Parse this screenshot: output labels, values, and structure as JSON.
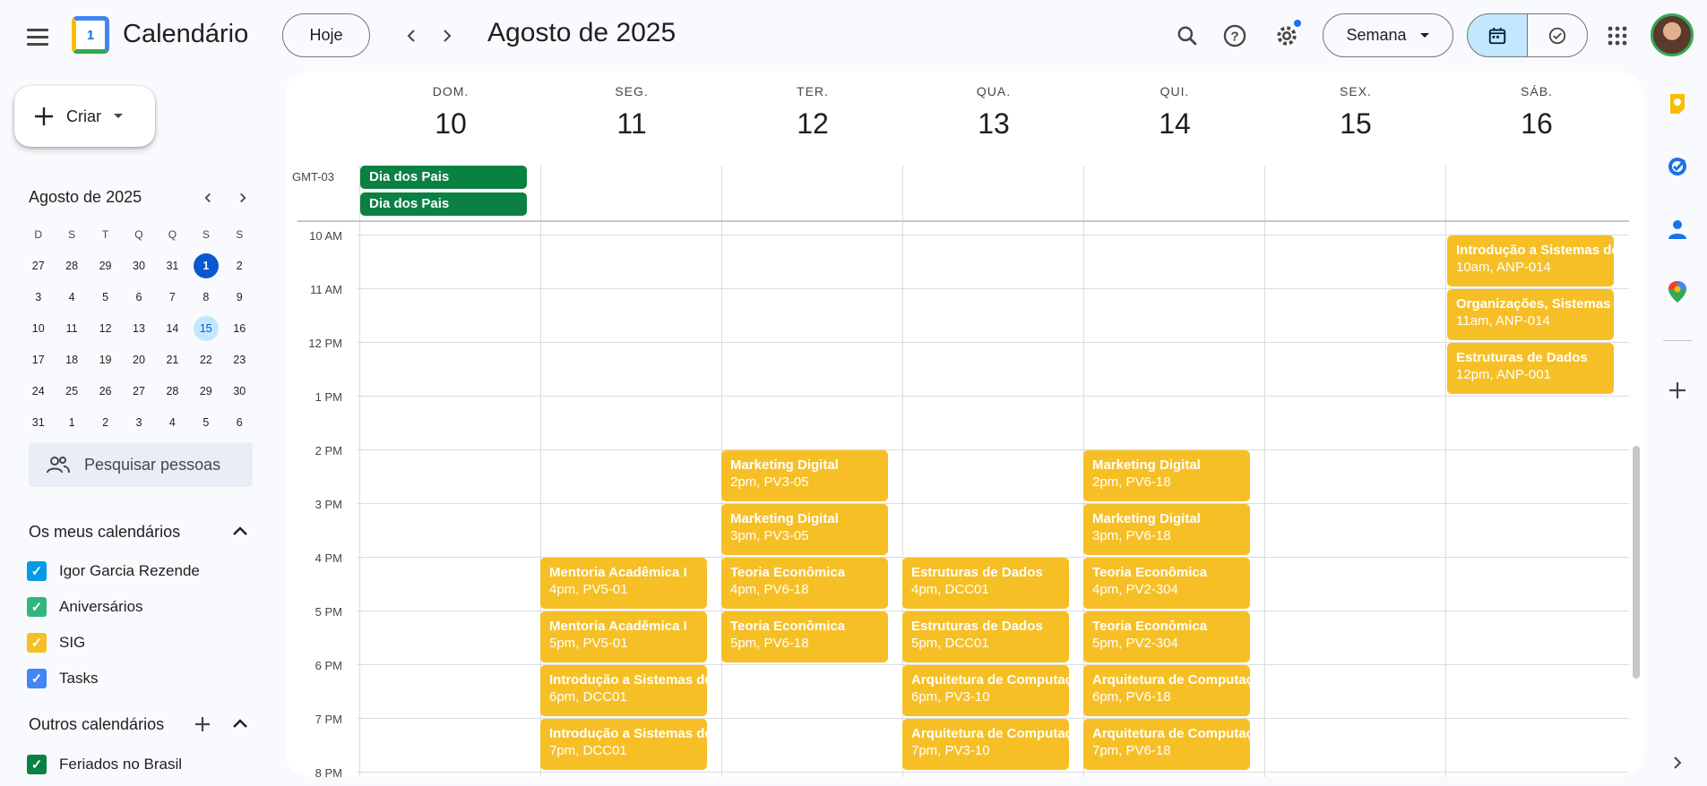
{
  "header": {
    "app_title": "Calendário",
    "logo_number": "1",
    "today_label": "Hoje",
    "period": "Agosto de 2025",
    "view_label": "Semana"
  },
  "sidebar": {
    "create_label": "Criar",
    "mini_cal": {
      "title": "Agosto de 2025",
      "weekdays": [
        "D",
        "S",
        "T",
        "Q",
        "Q",
        "S",
        "S"
      ],
      "weeks": [
        [
          "27",
          "28",
          "29",
          "30",
          "31",
          "1",
          "2"
        ],
        [
          "3",
          "4",
          "5",
          "6",
          "7",
          "8",
          "9"
        ],
        [
          "10",
          "11",
          "12",
          "13",
          "14",
          "15",
          "16"
        ],
        [
          "17",
          "18",
          "19",
          "20",
          "21",
          "22",
          "23"
        ],
        [
          "24",
          "25",
          "26",
          "27",
          "28",
          "29",
          "30"
        ],
        [
          "31",
          "1",
          "2",
          "3",
          "4",
          "5",
          "6"
        ]
      ]
    },
    "search_people": "Pesquisar pessoas",
    "my_calendars_title": "Os meus calendários",
    "my_calendars": [
      {
        "label": "Igor Garcia Rezende",
        "color": "#039be5"
      },
      {
        "label": "Aniversários",
        "color": "#33b679"
      },
      {
        "label": "SIG",
        "color": "#f6bf26"
      },
      {
        "label": "Tasks",
        "color": "#4285f4"
      }
    ],
    "other_calendars_title": "Outros calendários",
    "other_calendars": [
      {
        "label": "Feriados no Brasil",
        "color": "#0b8043"
      }
    ]
  },
  "week": {
    "timezone": "GMT-03",
    "days": [
      {
        "name": "DOM.",
        "date": "10"
      },
      {
        "name": "SEG.",
        "date": "11"
      },
      {
        "name": "TER.",
        "date": "12"
      },
      {
        "name": "QUA.",
        "date": "13"
      },
      {
        "name": "QUI.",
        "date": "14"
      },
      {
        "name": "SEX.",
        "date": "15"
      },
      {
        "name": "SÁB.",
        "date": "16"
      }
    ],
    "hours": [
      "10 AM",
      "11 AM",
      "12 PM",
      "1 PM",
      "2 PM",
      "3 PM",
      "4 PM",
      "5 PM",
      "6 PM",
      "7 PM",
      "8 PM"
    ],
    "all_day": [
      {
        "title": "Dia dos Pais"
      },
      {
        "title": "Dia dos Pais"
      }
    ],
    "events": [
      {
        "title": "Introdução a Sistemas de",
        "detail": "10am, ANP-014"
      },
      {
        "title": "Organizações, Sistemas e",
        "detail": "11am, ANP-014"
      },
      {
        "title": "Estruturas de Dados",
        "detail": "12pm, ANP-001"
      },
      {
        "title": "Marketing Digital",
        "detail": "2pm, PV3-05"
      },
      {
        "title": "Marketing Digital",
        "detail": "3pm, PV3-05"
      },
      {
        "title": "Teoria Econômica",
        "detail": "4pm, PV6-18"
      },
      {
        "title": "Teoria Econômica",
        "detail": "5pm, PV6-18"
      },
      {
        "title": "Marketing Digital",
        "detail": "2pm, PV6-18"
      },
      {
        "title": "Marketing Digital",
        "detail": "3pm, PV6-18"
      },
      {
        "title": "Teoria Econômica",
        "detail": "4pm, PV2-304"
      },
      {
        "title": "Teoria Econômica",
        "detail": "5pm, PV2-304"
      },
      {
        "title": "Arquitetura de Computação",
        "detail": "6pm, PV6-18"
      },
      {
        "title": "Arquitetura de Computação",
        "detail": "7pm, PV6-18"
      },
      {
        "title": "Mentoria Acadêmica I",
        "detail": "4pm, PV5-01"
      },
      {
        "title": "Mentoria Acadêmica I",
        "detail": "5pm, PV5-01"
      },
      {
        "title": "Introdução a Sistemas de",
        "detail": "6pm, DCC01"
      },
      {
        "title": "Introdução a Sistemas de",
        "detail": "7pm, DCC01"
      },
      {
        "title": "Estruturas de Dados",
        "detail": "4pm, DCC01"
      },
      {
        "title": "Estruturas de Dados",
        "detail": "5pm, DCC01"
      },
      {
        "title": "Arquitetura de Computação",
        "detail": "6pm, PV3-10"
      },
      {
        "title": "Arquitetura de Computação",
        "detail": "7pm, PV3-10"
      }
    ]
  },
  "colors": {
    "accent": "#0b57d0",
    "event_yellow": "#f6bf26",
    "holiday_green": "#0b8043"
  }
}
